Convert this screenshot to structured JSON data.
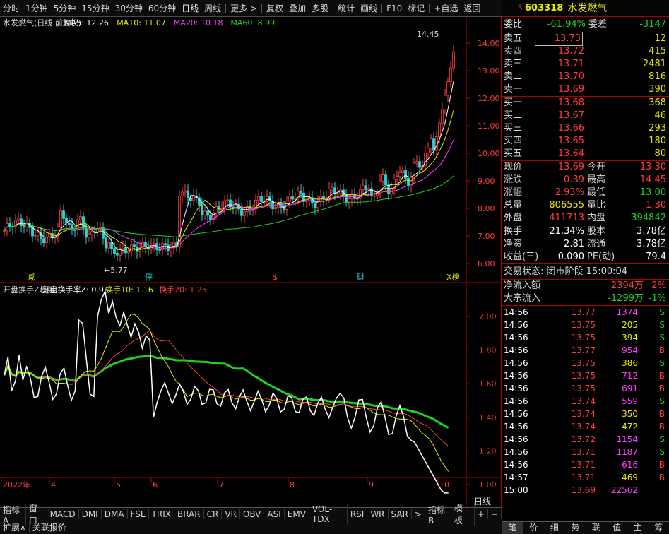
{
  "toolbar": {
    "items": [
      "分时",
      "1分钟",
      "5分钟",
      "15分钟",
      "30分钟",
      "60分钟",
      "日线",
      "周线",
      "更多 >",
      "复权",
      "叠加",
      "多股",
      "统计",
      "画线",
      "F10",
      "标记",
      "+自选",
      "返回"
    ]
  },
  "chart": {
    "title": "水发燃气(日线 前复权)",
    "ma5": "MA5: 12.26",
    "ma10": "MA10: 11.07",
    "ma20": "MA20: 10.18",
    "ma60": "MA60: 8.99",
    "y_labels": [
      "14.00",
      "13.00",
      "12.00",
      "11.00",
      "10.00",
      "9.00",
      "8.00",
      "7.00",
      "6.00"
    ],
    "high_label": "14.45",
    "low_label": "5.77",
    "events": [
      "减",
      "停",
      "$",
      "财",
      "X榜"
    ],
    "indicator_title": "开盘换手Z趋势",
    "ind_z": "开盘换手率Z: 0.95",
    "ind_10": "换手10: 1.16",
    "ind_20": "换手20: 1.25",
    "ind_y_labels": [
      "2.00",
      "1.80",
      "1.60",
      "1.40",
      "1.20",
      "1.00"
    ],
    "x_labels": [
      "2022年",
      "4",
      "5",
      "6",
      "7",
      "8",
      "9",
      "10"
    ]
  },
  "bottom": {
    "tabs": [
      "指标A",
      "窗口",
      "MACD",
      "DMI",
      "DMA",
      "FSL",
      "TRIX",
      "BRAR",
      "CR",
      "VR",
      "OBV",
      "ASI",
      "EMV",
      "VOL-TDX",
      "RSI",
      "WR",
      "SAR",
      ">",
      "指标B",
      "模 板",
      "+",
      "−"
    ],
    "row2": [
      "扩展∧",
      "关联报价"
    ],
    "period": "日线"
  },
  "quote": {
    "flag": "R",
    "code": "603318",
    "name": "水发燃气",
    "weibi_label": "委比",
    "weibi": "-61.94%",
    "weicha_label": "委差",
    "weicha": "-3147",
    "asks": [
      {
        "label": "卖五",
        "price": "13.73",
        "vol": "12"
      },
      {
        "label": "卖四",
        "price": "13.72",
        "vol": "415"
      },
      {
        "label": "卖三",
        "price": "13.71",
        "vol": "2481"
      },
      {
        "label": "卖二",
        "price": "13.70",
        "vol": "816"
      },
      {
        "label": "卖一",
        "price": "13.69",
        "vol": "390"
      }
    ],
    "bids": [
      {
        "label": "买一",
        "price": "13.68",
        "vol": "368"
      },
      {
        "label": "买二",
        "price": "13.67",
        "vol": "46"
      },
      {
        "label": "买三",
        "price": "13.66",
        "vol": "293"
      },
      {
        "label": "买四",
        "price": "13.65",
        "vol": "180"
      },
      {
        "label": "买五",
        "price": "13.64",
        "vol": "80"
      }
    ],
    "stats": [
      {
        "l1": "现价",
        "v1": "13.69",
        "l2": "今开",
        "v2": "13.30"
      },
      {
        "l1": "涨跌",
        "v1": "0.39",
        "l2": "最高",
        "v2": "14.45"
      },
      {
        "l1": "涨幅",
        "v1": "2.93%",
        "l2": "最低",
        "v2": "13.00"
      },
      {
        "l1": "总量",
        "v1": "806555",
        "l2": "量比",
        "v2": "1.30"
      },
      {
        "l1": "外盘",
        "v1": "411713",
        "l2": "内盘",
        "v2": "394842"
      }
    ],
    "stats2": [
      {
        "l1": "换手",
        "v1": "21.34%",
        "l2": "股本",
        "v2": "3.78亿"
      },
      {
        "l1": "净资",
        "v1": "2.81",
        "l2": "流通",
        "v2": "3.78亿"
      },
      {
        "l1": "收益(三)",
        "v1": "0.090",
        "l2": "PE(动)",
        "v2": "79.4"
      }
    ],
    "trade_state": "交易状态: 闭市阶段 15:00:04",
    "net_inflow_label": "净流入额",
    "net_inflow": "2394万",
    "net_inflow_pct": "2%",
    "block_label": "大宗流入",
    "block": "-1299万",
    "block_pct": "-1%",
    "ticks": [
      {
        "t": "14:56",
        "p": "13.77",
        "v": "1374",
        "s": "S"
      },
      {
        "t": "14:56",
        "p": "13.75",
        "v": "205",
        "s": "S"
      },
      {
        "t": "14:56",
        "p": "13.75",
        "v": "394",
        "s": "S"
      },
      {
        "t": "14:56",
        "p": "13.77",
        "v": "954",
        "s": "B"
      },
      {
        "t": "14:56",
        "p": "13.75",
        "v": "386",
        "s": "S"
      },
      {
        "t": "14:56",
        "p": "13.75",
        "v": "712",
        "s": "B"
      },
      {
        "t": "14:56",
        "p": "13.75",
        "v": "691",
        "s": "B"
      },
      {
        "t": "14:56",
        "p": "13.74",
        "v": "559",
        "s": "S"
      },
      {
        "t": "14:56",
        "p": "13.74",
        "v": "350",
        "s": "B"
      },
      {
        "t": "14:56",
        "p": "13.74",
        "v": "472",
        "s": "B"
      },
      {
        "t": "14:56",
        "p": "13.72",
        "v": "1154",
        "s": "S"
      },
      {
        "t": "14:56",
        "p": "13.71",
        "v": "1187",
        "s": "S"
      },
      {
        "t": "14:56",
        "p": "13.71",
        "v": "616",
        "s": "B"
      },
      {
        "t": "14:57",
        "p": "13.71",
        "v": "469",
        "s": "B"
      },
      {
        "t": "15:00",
        "p": "13.69",
        "v": "22562",
        "s": ""
      }
    ],
    "tabs": [
      "笔",
      "价",
      "细",
      "势",
      "联",
      "值",
      "主",
      "筹"
    ]
  },
  "colors": {
    "up": "#ff3c3c",
    "down": "#22d8d8",
    "ma5": "#ffffff",
    "ma10": "#e8e800",
    "ma20": "#ff3cff",
    "ma60": "#20d020"
  }
}
